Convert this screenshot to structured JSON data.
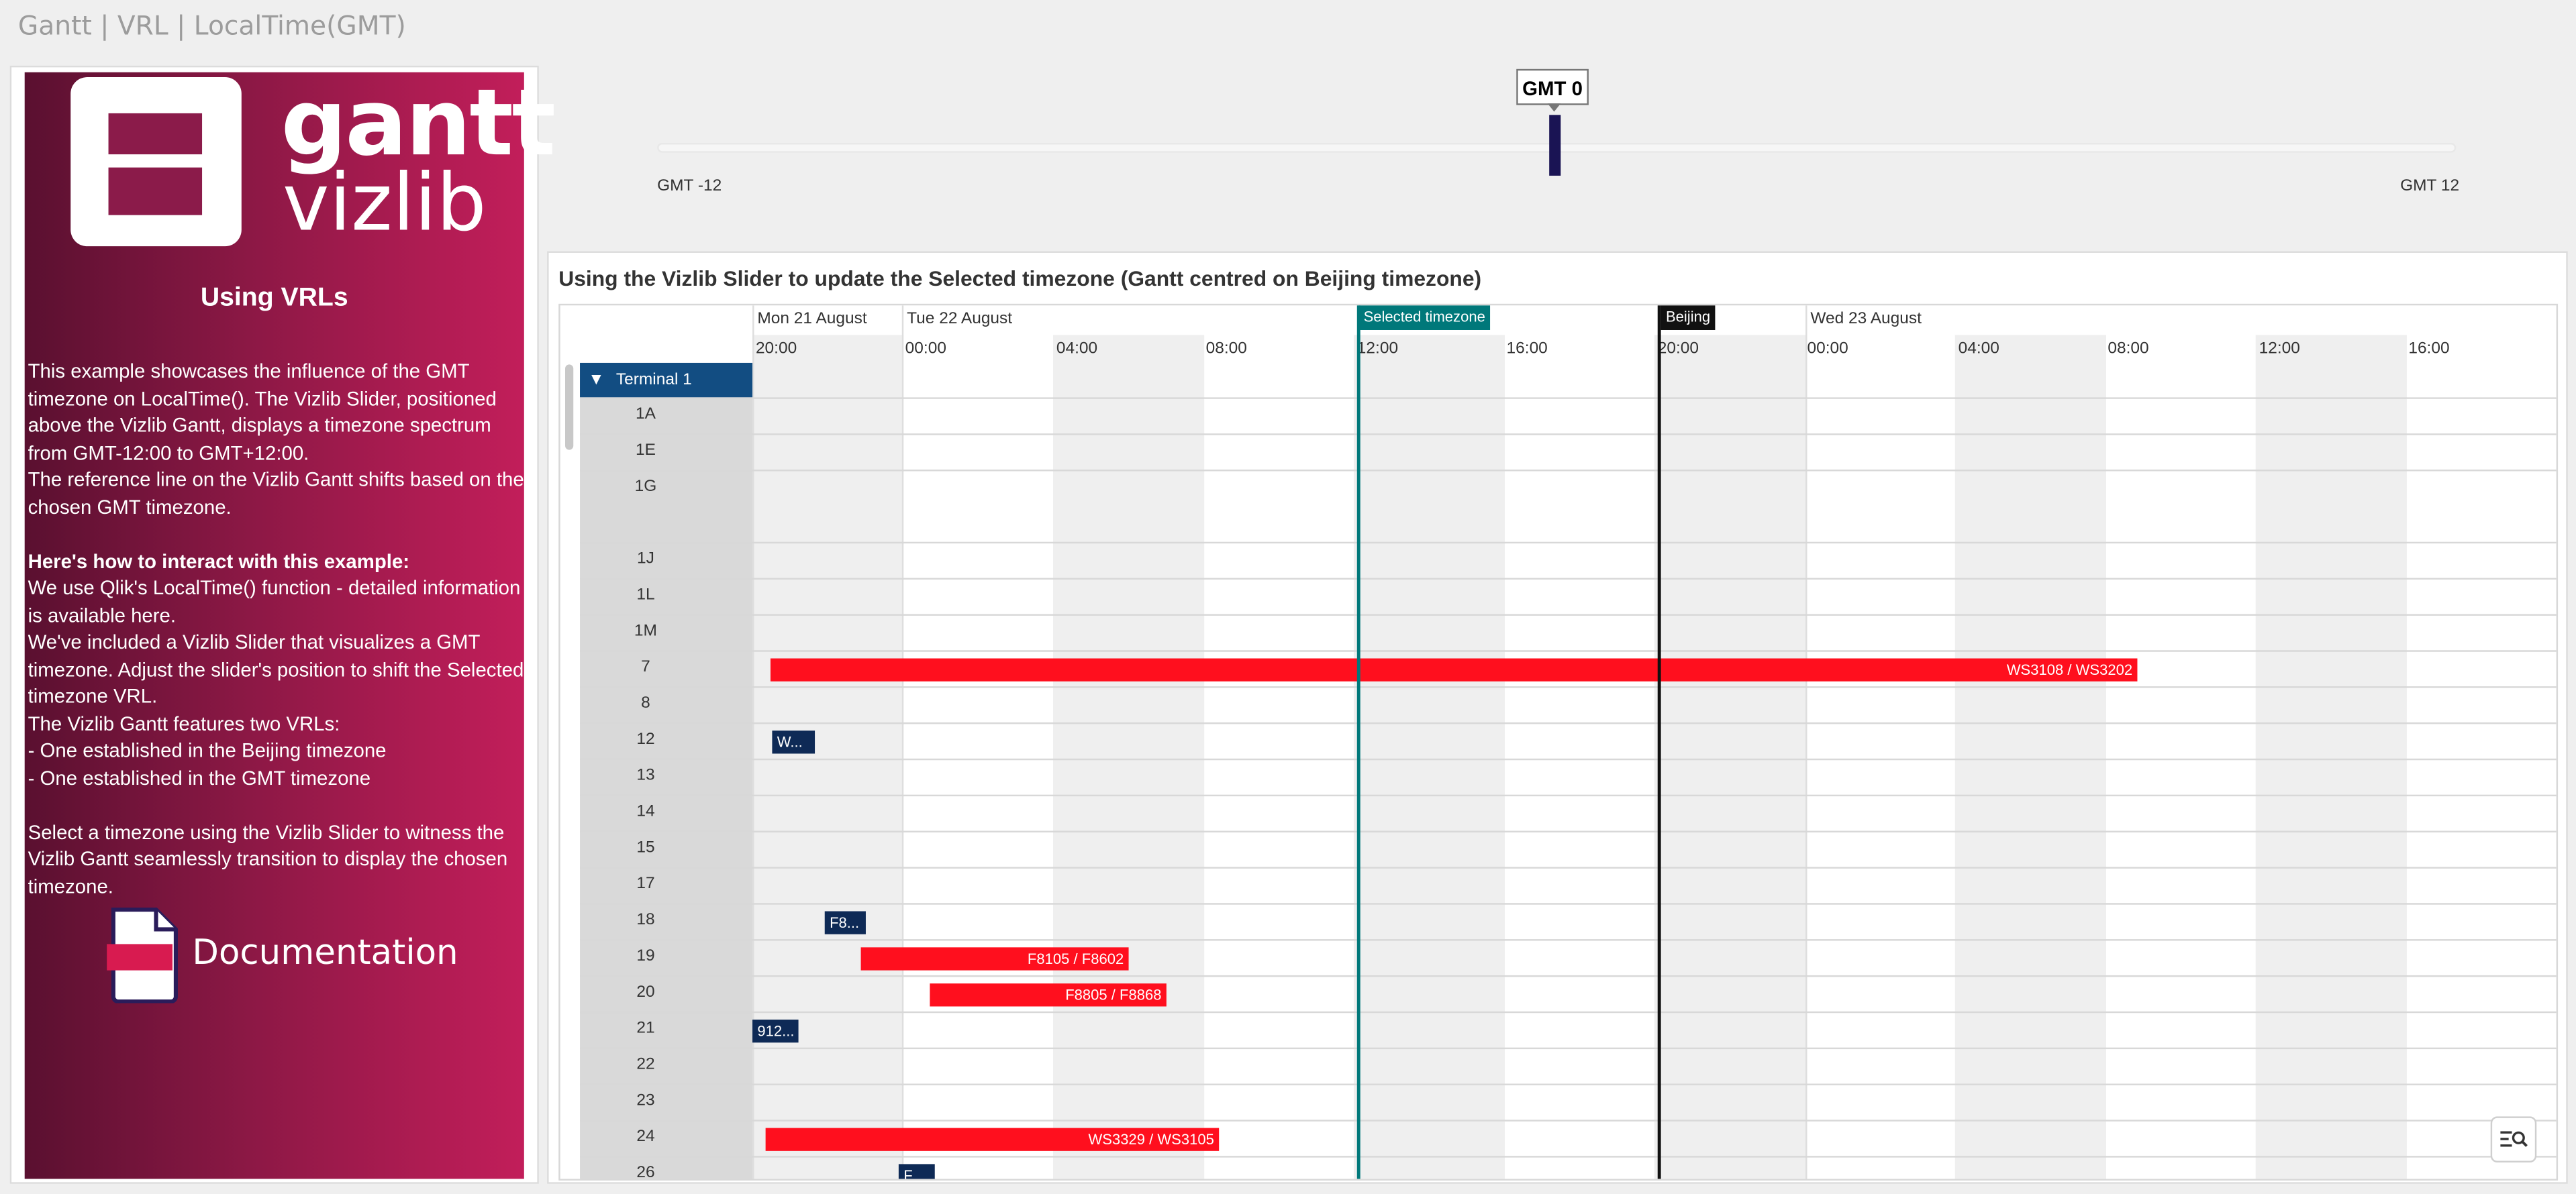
{
  "app": {
    "title": "Gantt | VRL | LocalTime(GMT)"
  },
  "info_panel": {
    "logo_word_1": "gantt",
    "logo_word_2": "vizlib",
    "heading": "Using VRLs",
    "intro": "This example showcases the influence of the GMT timezone on LocalTime(). The Vizlib Slider, positioned above the Vizlib Gantt, displays a timezone spectrum from GMT-12:00 to GMT+12:00.",
    "intro2": "The reference line on the Vizlib Gantt shifts based on the chosen GMT timezone.",
    "howto_heading": "Here's how to interact with this example:",
    "line_1_prefix": "We use Qlik's LocalTime() function - detailed information is available ",
    "line_1_link": "here",
    "line_1_suffix": ".",
    "line_2": "We've included a Vizlib Slider that visualizes a GMT timezone. Adjust the slider's position to shift the Selected timezone VRL.",
    "line_3": "The Vizlib Gantt features two VRLs:",
    "line_4": "- One established in the Beijing timezone",
    "line_5": "- One established in the GMT timezone",
    "closing": "Select a timezone using the Vizlib Slider to witness the Vizlib Gantt seamlessly transition to display the chosen timezone.",
    "documentation_label": "Documentation"
  },
  "slider": {
    "tooltip": "GMT 0",
    "min_label": "GMT -12",
    "max_label": "GMT 12",
    "min": -12,
    "max": 12,
    "value": 0,
    "handle_color": "#1a1454"
  },
  "gantt": {
    "title": "Using the Vizlib Slider to update the Selected timezone (Gantt centred on Beijing timezone)",
    "dates": [
      "Mon 21 August",
      "Tue 22 August",
      "Wed 23 August"
    ],
    "hours": [
      "20:00",
      "00:00",
      "04:00",
      "08:00",
      "12:00",
      "16:00",
      "20:00",
      "00:00",
      "04:00",
      "08:00",
      "12:00",
      "16:00"
    ],
    "reference_lines": [
      {
        "label": "Selected timezone",
        "color": "#00787a"
      },
      {
        "label": "Beijing",
        "color": "#111111"
      }
    ],
    "group": "Terminal 1",
    "rows": [
      "1A",
      "1E",
      "1G",
      "1J",
      "1L",
      "1M",
      "7",
      "8",
      "12",
      "13",
      "14",
      "15",
      "17",
      "18",
      "19",
      "20",
      "21",
      "22",
      "23",
      "24",
      "26"
    ],
    "bars": [
      {
        "row": "7",
        "label": "WS3108 / WS3202",
        "color": "#ff0f1e"
      },
      {
        "row": "12",
        "label": "W...",
        "color": "#0e2a56"
      },
      {
        "row": "18",
        "label": "F8...",
        "color": "#0e2a56"
      },
      {
        "row": "19",
        "label": "F8105 / F8602",
        "color": "#ff0f1e"
      },
      {
        "row": "20",
        "label": "F8805 / F8868",
        "color": "#ff0f1e"
      },
      {
        "row": "21",
        "label": "912...",
        "color": "#0e2a56"
      },
      {
        "row": "24",
        "label": "WS3329 / WS3105",
        "color": "#ff0f1e"
      },
      {
        "row": "26",
        "label": "F...",
        "color": "#0e2a56"
      }
    ],
    "zoom_icon": "zoom-list-icon"
  }
}
